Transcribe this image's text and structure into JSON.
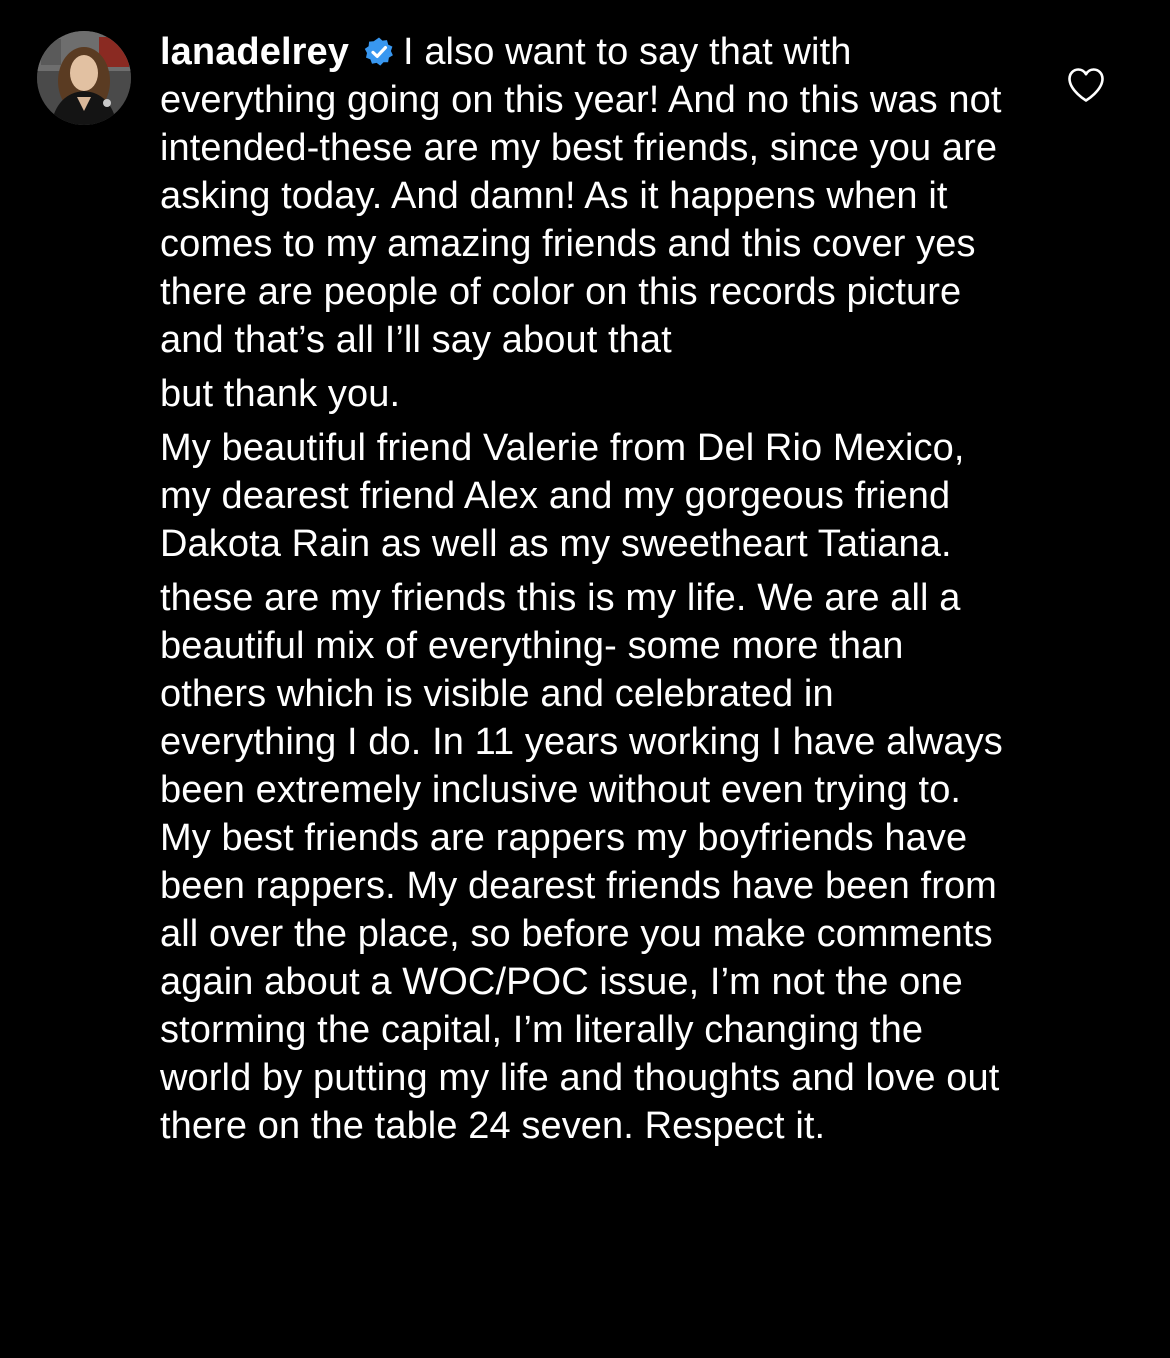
{
  "comment": {
    "username": "lanadelrey",
    "verified": true,
    "paragraphs": [
      "I also want to say that with everything going on this year! And no this was not intended-these are my best friends, since you are asking today. And damn! As it happens when it comes to my amazing friends and this cover yes there are people of color on this records picture and that’s all I’ll say about that",
      "but thank you.",
      "My beautiful friend Valerie from Del Rio Mexico, my dearest friend Alex and my gorgeous friend Dakota Rain as well as my sweetheart Tatiana.",
      "these are my friends this is my life. We are all a beautiful mix of everything- some more than others which is visible and celebrated in everything I do. In 11 years working I have always been extremely inclusive without even trying to. My best friends are rappers my boyfriends have been rappers. My dearest friends have been from all over the place, so before you make comments again  about a WOC/POC issue, I’m not the one storming the capital, I’m literally changing the world by putting my life and thoughts and love  out there on the table 24 seven. Respect it."
    ]
  },
  "icons": {
    "avatar": "profile-photo",
    "verified": "verified-badge-icon",
    "like": "heart-outline-icon"
  },
  "colors": {
    "background": "#000000",
    "text": "#ffffff",
    "verified_badge": "#3897f0",
    "like_icon": "#ffffff"
  }
}
